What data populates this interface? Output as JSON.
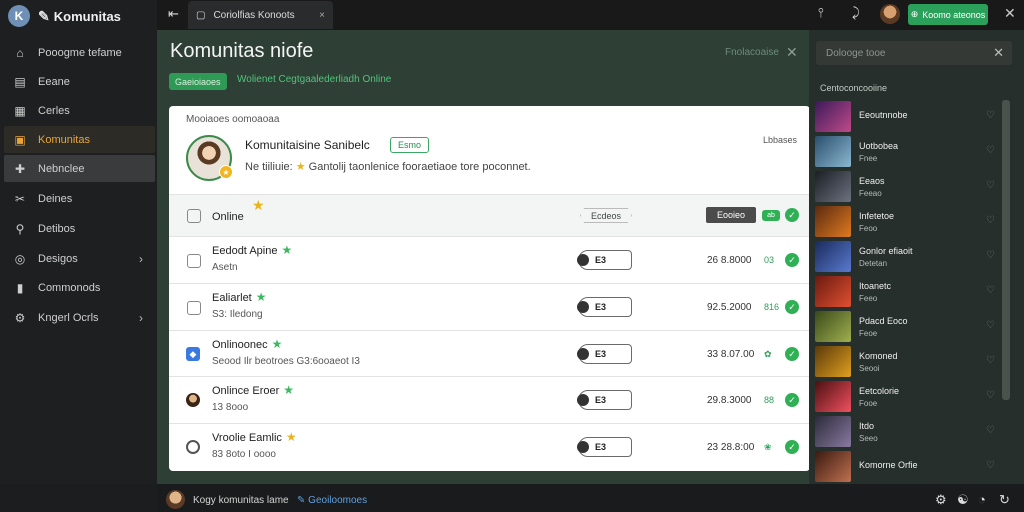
{
  "app": {
    "logo_letter": "K",
    "brand": "Komunitas"
  },
  "sidebar": {
    "items": [
      {
        "label": "Pooogme tefame",
        "icon": "home-icon"
      },
      {
        "label": "Eeane",
        "icon": "box-icon"
      },
      {
        "label": "Cerles",
        "icon": "image-icon"
      },
      {
        "label": "Komunitas",
        "icon": "community-icon",
        "active": true
      },
      {
        "label": "Nebnclee",
        "icon": "grid-icon",
        "hover": true
      },
      {
        "label": "Deines",
        "icon": "tools-icon"
      },
      {
        "label": "Detibos",
        "icon": "wrench-icon"
      },
      {
        "label": "Desigos",
        "icon": "circle-icon",
        "chevron": "›"
      },
      {
        "label": "Commonods",
        "icon": "book-icon"
      },
      {
        "label": "Kngerl Ocrls",
        "icon": "settings-icon",
        "chevron": "›"
      }
    ]
  },
  "topbar": {
    "back": "⇤",
    "tab_title": "Coriolfias Konoots",
    "tab_close": "×",
    "icon1": "⫯",
    "icon2": "⤸",
    "button_label": "Koomo ateonos",
    "close": "✕"
  },
  "main": {
    "title": "Komunitas niofe",
    "online_pill": "Gaeioiaoes",
    "status_line": "Wolienet Cegtgaalederliadh Online",
    "header_right": "Fnolacoaise",
    "header_close": "✕"
  },
  "card": {
    "heading": "Mooiaoes oomoaoaa",
    "date": "Lbbases",
    "profile": {
      "name": "Komunitaisine Sanibelc",
      "tag": "Esmo",
      "desc_prefix": "Ne tiiliuie: ",
      "desc_suffix": " Gantolij taonlenice fooraetiaoe tore poconnet.",
      "badge": "★"
    },
    "online_row": {
      "label": "Online",
      "tag": "Ecdeos",
      "button": "Eooieo",
      "mini": "ab"
    },
    "rows": [
      {
        "name": "Eedodt Apine",
        "sub": "Asetn",
        "pill": "E3",
        "value": "26 8.8000",
        "small": "03",
        "star": "green",
        "lead": "checkbox"
      },
      {
        "name": "Ealiarlet",
        "sub": "S3: Iledong",
        "pill": "E3",
        "value": "92.5.2000",
        "small": "816",
        "star": "green",
        "lead": "checkbox"
      },
      {
        "name": "Onlinoonec",
        "sub": "Seood Ilr beotroes G3:6ooaeot I3",
        "pill": "E3",
        "value": "33 8.07.00",
        "small": "✿",
        "star": "green",
        "lead": "blue"
      },
      {
        "name": "Onlince Eroer",
        "sub": "13 8ooo",
        "pill": "E3",
        "value": "29.8.3000",
        "small": "88",
        "star": "green",
        "lead": "avatar"
      },
      {
        "name": "Vroolie Eamlic",
        "sub": "83 8oto   I oooo",
        "pill": "E3",
        "value": "23 28.8:00",
        "small": "❀",
        "star": "gold",
        "lead": "ring"
      }
    ]
  },
  "rightpanel": {
    "search_placeholder": "Dolooge tooe",
    "search_close": "✕",
    "heading": "Centoconcooiine",
    "games": [
      {
        "name": "Eeoutnnobe",
        "sub": "",
        "color1": "#3a1a5a",
        "color2": "#c04a8a"
      },
      {
        "name": "Uotbobea",
        "sub": "Fnee",
        "color1": "#2a4e6e",
        "color2": "#8bb8d0"
      },
      {
        "name": "Eeaos",
        "sub": "Feeao",
        "color1": "#1b1e24",
        "color2": "#6c7280"
      },
      {
        "name": "Infetetoe",
        "sub": "Feoo",
        "color1": "#5a2a10",
        "color2": "#e07a20"
      },
      {
        "name": "Gonlor efiaoit",
        "sub": "Detetan",
        "color1": "#1a2a5a",
        "color2": "#5a7ad0"
      },
      {
        "name": "Itoanetc",
        "sub": "Feeo",
        "color1": "#6a1a10",
        "color2": "#e05030"
      },
      {
        "name": "Pdacd Eoco",
        "sub": "Feoe",
        "color1": "#3a4a1a",
        "color2": "#a0b050"
      },
      {
        "name": "Komoned",
        "sub": "Seooi",
        "color1": "#5a3a0a",
        "color2": "#e0a020"
      },
      {
        "name": "Eetcolorie",
        "sub": "Fooe",
        "color1": "#4a1010",
        "color2": "#f05060"
      },
      {
        "name": "Itdo",
        "sub": "Seeo",
        "color1": "#2a2a3a",
        "color2": "#8a7aa0"
      },
      {
        "name": "Komorne Orfie",
        "sub": "",
        "color1": "#3a1a10",
        "color2": "#c07050"
      }
    ]
  },
  "bottom": {
    "text": "Kogy komunitas lame",
    "link": "Geoiloomoes",
    "icons": [
      "⚙",
      "☯",
      "◔",
      "↻"
    ]
  }
}
